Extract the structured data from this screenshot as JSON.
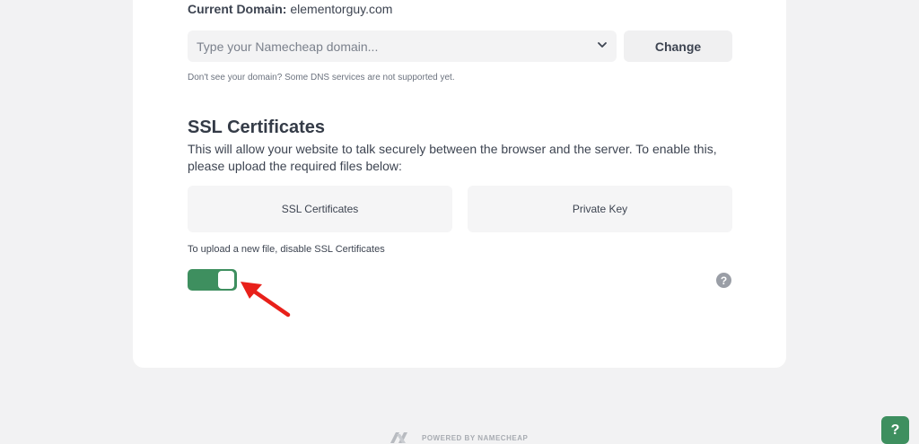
{
  "domain": {
    "current_label": "Current Domain:",
    "current_value": "elementorguy.com",
    "select_placeholder": "Type your Namecheap domain...",
    "change_label": "Change",
    "hint": "Don't see your domain? Some DNS services are not supported yet."
  },
  "ssl": {
    "title": "SSL Certificates",
    "description": "This will allow your website to talk securely between the browser and the server. To enable this, please upload the required files below:",
    "box_certificates": "SSL Certificates",
    "box_private_key": "Private Key",
    "upload_hint": "To upload a new file, disable SSL Certificates",
    "toggle_state": "on",
    "help_glyph": "?"
  },
  "footer": {
    "powered_by": "POWERED BY NAMECHEAP"
  },
  "help_fab": {
    "glyph": "?"
  },
  "colors": {
    "accent_green": "#3e8f5f",
    "annotation_red": "#e8201a"
  },
  "icons": [
    "chevron-down-icon",
    "help-icon",
    "namecheap-logo-icon",
    "annotation-arrow-icon"
  ]
}
